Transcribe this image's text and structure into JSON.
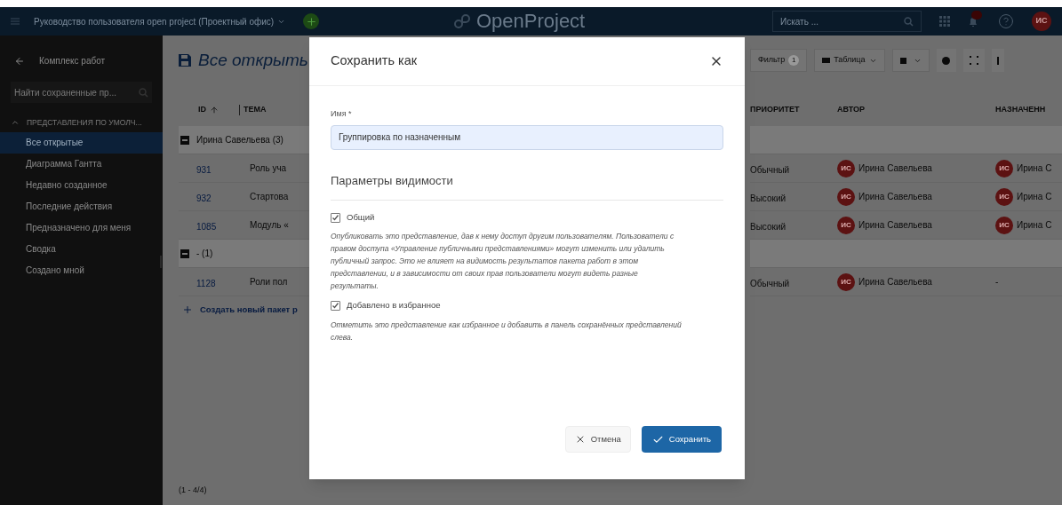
{
  "topbar": {
    "project": "Руководство пользователя open project (Проектный офис)",
    "logo": "OpenProject",
    "search": {
      "placeholder": "Искать ..."
    },
    "avatar": "ИС"
  },
  "sidebar": {
    "back_title": "Комплекс работ",
    "search": {
      "placeholder": "Найти сохраненные пр..."
    },
    "section": {
      "label": "ПРЕДСТАВЛЕНИЯ ПО УМОЛЧ...",
      "expanded": true
    },
    "items": [
      {
        "label": "Все открытые",
        "selected": true
      },
      {
        "label": "Диаграмма Гантта",
        "selected": false
      },
      {
        "label": "Недавно созданное",
        "selected": false
      },
      {
        "label": "Последние действия",
        "selected": false
      },
      {
        "label": "Предназначено для меня",
        "selected": false
      },
      {
        "label": "Сводка",
        "selected": false
      },
      {
        "label": "Создано мной",
        "selected": false
      }
    ]
  },
  "main": {
    "title": "Все открыть",
    "toolbar": {
      "filter": "Фильтр",
      "filter_count": "1",
      "view": "Таблица"
    },
    "columns_left": [
      "ID",
      "ТЕМА"
    ],
    "columns_right": [
      "ПРИОРИТЕТ",
      "АВТОР",
      "НАЗНАЧЕНН"
    ],
    "groups": [
      {
        "label": "Ирина Савельева (3)",
        "expanded": true,
        "rows": [
          {
            "id": "931",
            "subject": "Роль уча",
            "priority": "Обычный",
            "author": {
              "initials": "ИС",
              "name": "Ирина Савельева"
            },
            "assignee": {
              "initials": "ИС",
              "name": "Ирина С"
            }
          },
          {
            "id": "932",
            "subject": "Стартова",
            "priority": "Высокий",
            "author": {
              "initials": "ИС",
              "name": "Ирина Савельева"
            },
            "assignee": {
              "initials": "ИС",
              "name": "Ирина С"
            }
          },
          {
            "id": "1085",
            "subject": "Модуль «",
            "priority": "Высокий",
            "author": {
              "initials": "ИС",
              "name": "Ирина Савельева"
            },
            "assignee": {
              "initials": "ИС",
              "name": "Ирина С"
            }
          }
        ]
      },
      {
        "label": "- (1)",
        "expanded": true,
        "rows": [
          {
            "id": "1128",
            "subject": "Роли пол",
            "priority": "Обычный",
            "author": {
              "initials": "ИС",
              "name": "Ирина Савельева"
            },
            "assignee": {
              "text": "-"
            }
          }
        ]
      }
    ],
    "create_link": "Создать новый пакет р",
    "footer": "(1 - 4/4)"
  },
  "dialog": {
    "title": "Сохранить как",
    "field": {
      "label": "Имя",
      "required": "*",
      "value": "Группировка по назначенным"
    },
    "section": "Параметры видимости",
    "options": [
      {
        "label": "Общий",
        "checked": true,
        "description": "Опубликовать это представление, дав к нему доступ другим пользователям. Пользователи с правом доступа «Управление публичными представлениями» могут изменить или удалить публичный запрос. Это не влияет на видимость результатов пакета работ в этом представлении, и в зависимости от своих прав пользователи могут видеть разные результаты."
      },
      {
        "label": "Добавлено в избранное",
        "checked": true,
        "description": "Отметить это представление как избранное и добавить в панель сохранённых представлений слева."
      }
    ],
    "buttons": [
      {
        "label": "Отмена",
        "kind": "cancel"
      },
      {
        "label": "Сохранить",
        "kind": "primary"
      }
    ]
  }
}
